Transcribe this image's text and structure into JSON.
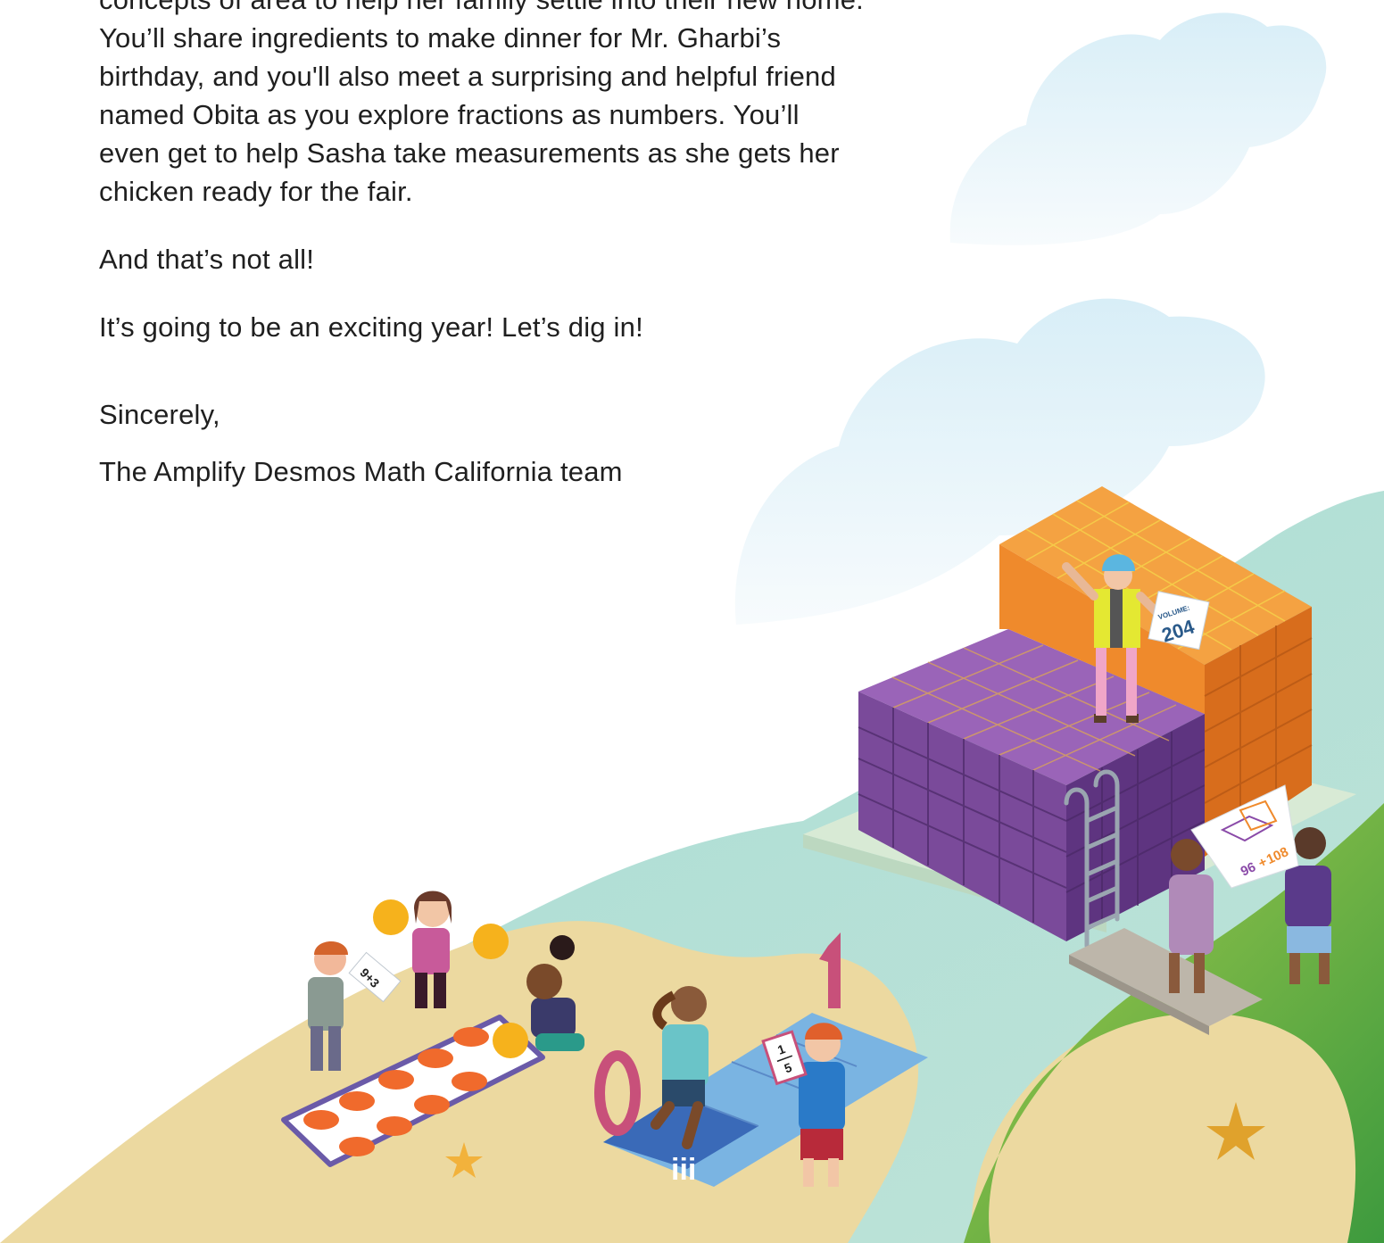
{
  "letter": {
    "paragraph": "concepts of area to help her family settle into their new home. You’ll share ingredients to make dinner for Mr. Gharbi’s birthday, and you'll also meet a surprising and helpful friend named Obita as you explore fractions as numbers. You’ll even get to help Sasha take measurements as she gets her chicken ready for the fair.",
    "line_1": "concepts of area to help her family settle into their new home.",
    "line_2": "You’ll share ingredients to make dinner for Mr. Gharbi’s",
    "line_3": "birthday, and you'll also meet a surprising and helpful friend",
    "line_4": "named Obita as you explore fractions as numbers. You’ll",
    "line_5": "even get to help Sasha take measurements as she gets her",
    "line_6": "chicken ready for the fair.",
    "not_all": "And that’s not all!",
    "exciting": "It’s going to be an exciting year! Let’s dig in!",
    "closing": "Sincerely,",
    "signature": "The Amplify Desmos Math California team"
  },
  "illustration": {
    "volume_sign_title": "VOLUME:",
    "volume_sign_value": "204",
    "flash_card": "9+3",
    "fraction_numerator": "1",
    "fraction_denominator": "5",
    "number_zero": "0",
    "number_one": "1",
    "tally": "iii",
    "blueprint_left": "96",
    "blueprint_plus": "+",
    "blueprint_right": "108"
  },
  "colors": {
    "sky_cloud": "#e3f2f8",
    "sand": "#ecd9a0",
    "water": "#9ed6d2",
    "grass": "#8fbf3f",
    "purple_blocks": "#7a4a9a",
    "orange_blocks": "#ef8a2c",
    "text": "#1f1f1f"
  }
}
